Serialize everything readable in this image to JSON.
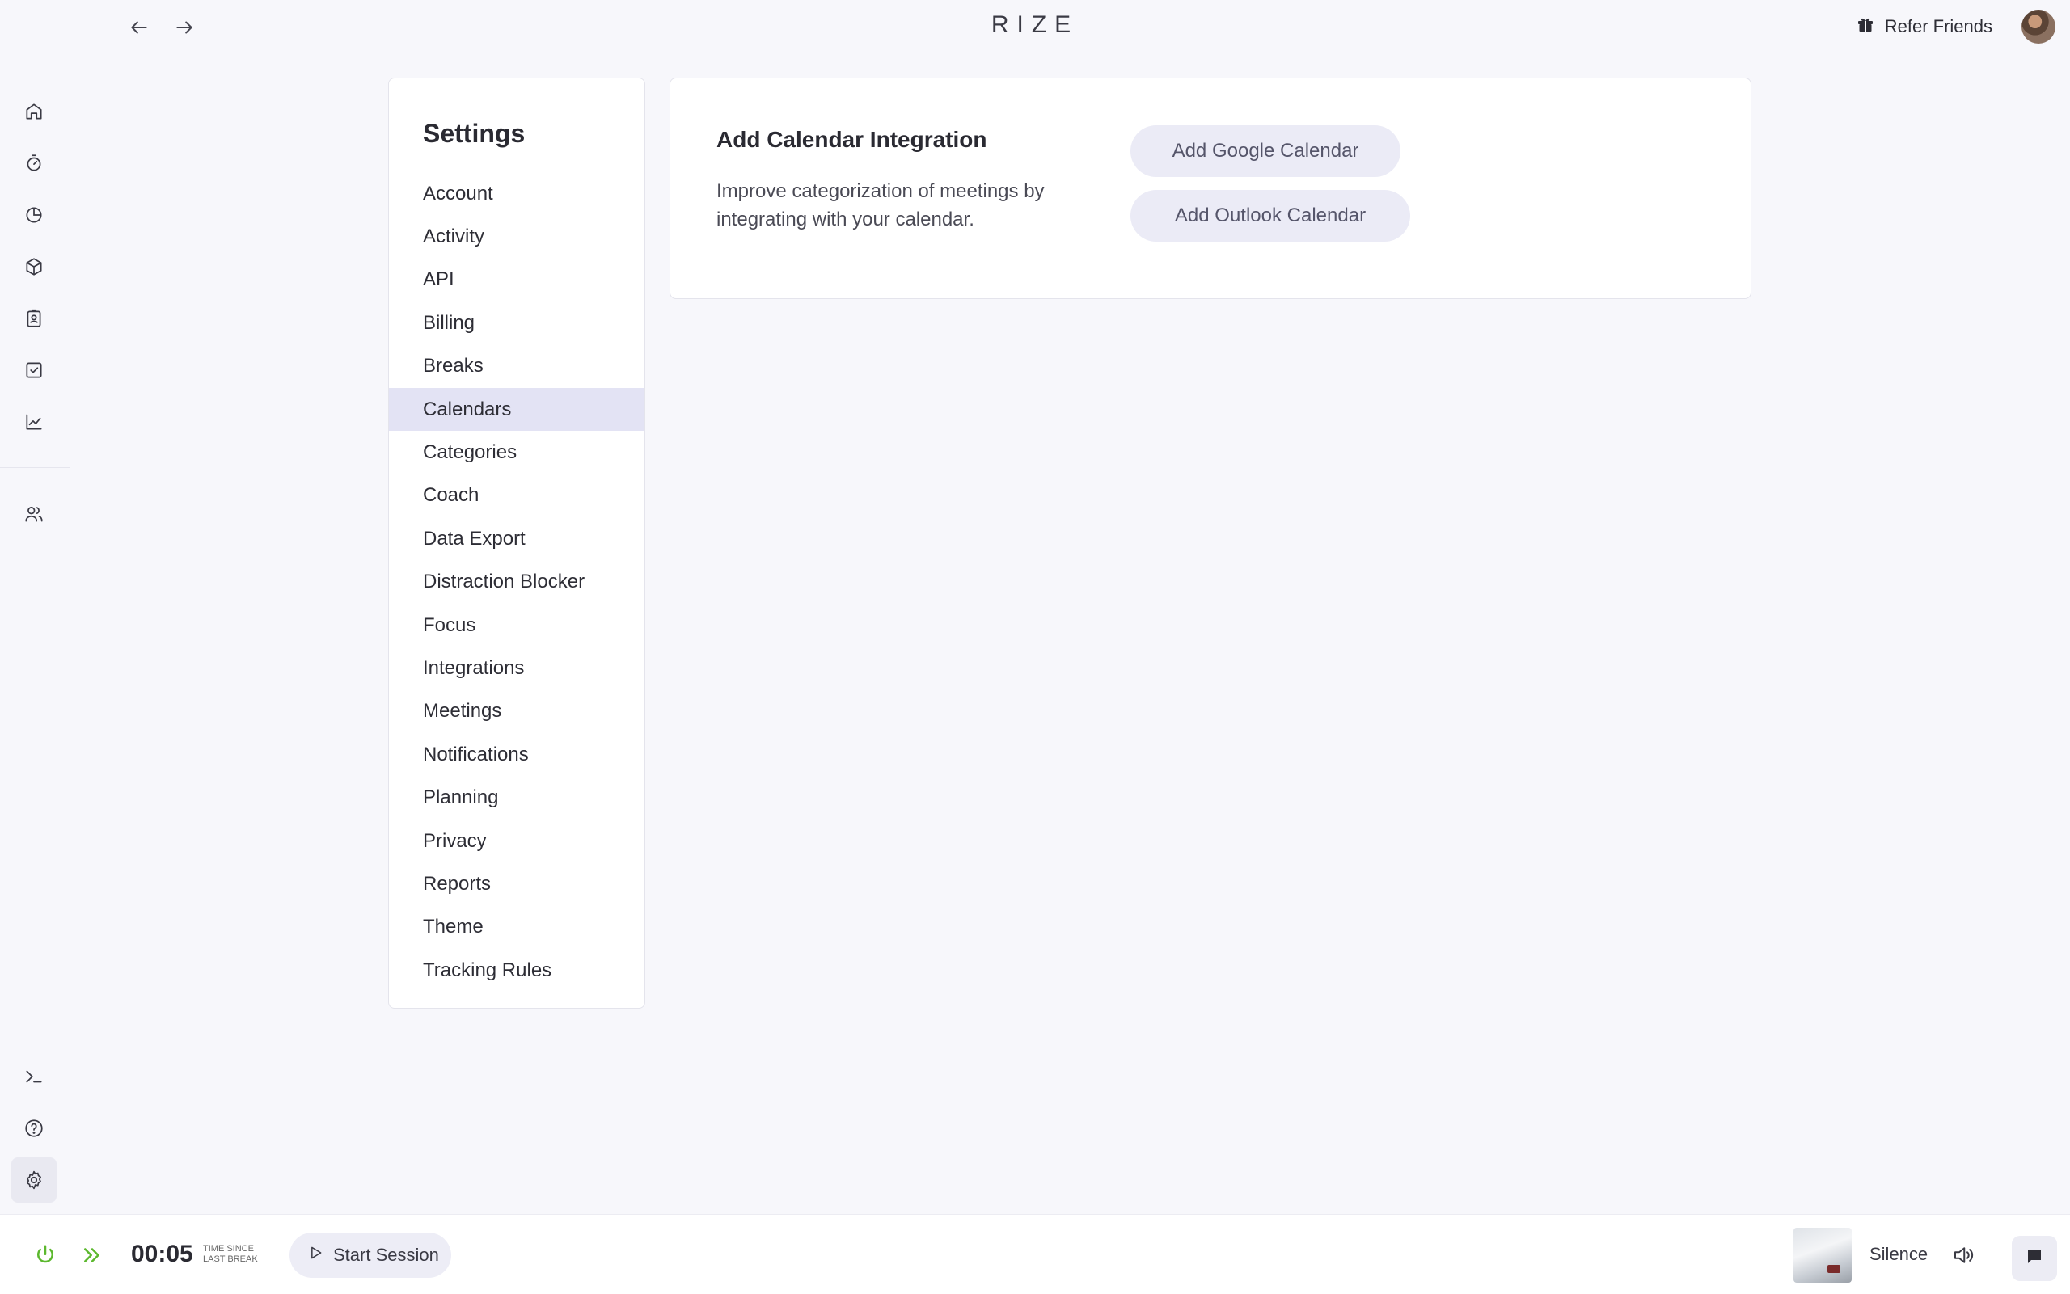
{
  "app": {
    "logo": "RIZE"
  },
  "topbar": {
    "refer_label": "Refer Friends"
  },
  "rail": {
    "items": [
      "home",
      "timer",
      "pie-chart",
      "projects",
      "clients",
      "tasks",
      "reports",
      "team"
    ],
    "bottom_items": [
      "terminal",
      "help",
      "settings"
    ],
    "active": "settings"
  },
  "settings": {
    "title": "Settings",
    "items": [
      {
        "label": "Account"
      },
      {
        "label": "Activity"
      },
      {
        "label": "API"
      },
      {
        "label": "Billing"
      },
      {
        "label": "Breaks"
      },
      {
        "label": "Calendars"
      },
      {
        "label": "Categories"
      },
      {
        "label": "Coach"
      },
      {
        "label": "Data Export"
      },
      {
        "label": "Distraction Blocker"
      },
      {
        "label": "Focus"
      },
      {
        "label": "Integrations"
      },
      {
        "label": "Meetings"
      },
      {
        "label": "Notifications"
      },
      {
        "label": "Planning"
      },
      {
        "label": "Privacy"
      },
      {
        "label": "Reports"
      },
      {
        "label": "Theme"
      },
      {
        "label": "Tracking Rules"
      }
    ],
    "active": "Calendars"
  },
  "calendar_card": {
    "title": "Add Calendar Integration",
    "description": "Improve categorization of meetings by integrating with your calendar.",
    "google_button": "Add Google Calendar",
    "outlook_button": "Add Outlook Calendar"
  },
  "bottombar": {
    "timer": "00:05",
    "timer_label_line1": "TIME SINCE",
    "timer_label_line2": "LAST BREAK",
    "start_label": "Start Session",
    "sound_label": "Silence"
  },
  "colors": {
    "accent_green": "#5cb82e",
    "active_bg": "#e3e3f4",
    "button_bg": "#ebebf6"
  }
}
